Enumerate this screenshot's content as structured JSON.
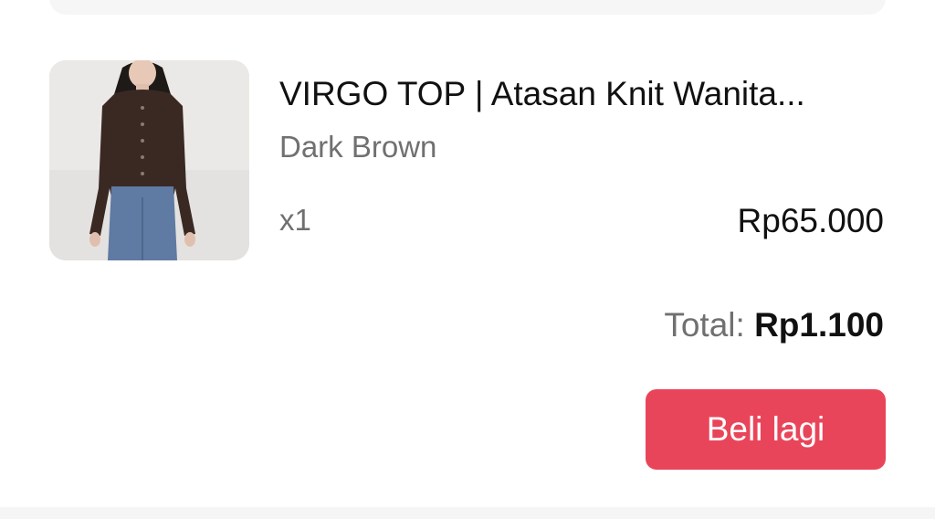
{
  "product": {
    "title": "VIRGO TOP | Atasan Knit Wanita...",
    "variant": "Dark Brown",
    "quantity": "x1",
    "price": "Rp65.000",
    "image_alt": "VIRGO TOP product photo"
  },
  "order": {
    "total_label": "Total:",
    "total_value": "Rp1.100"
  },
  "actions": {
    "buy_again_label": "Beli lagi"
  },
  "colors": {
    "accent": "#e9455a",
    "text_primary": "#111111",
    "text_secondary": "#707070",
    "background": "#f5f5f6"
  }
}
